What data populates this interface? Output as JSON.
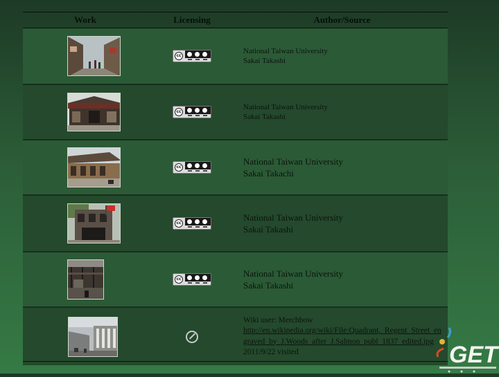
{
  "headers": {
    "work": "Work",
    "licensing": "Licensing",
    "author": "Author/Source"
  },
  "colors": {
    "row_light": "#2b5a36",
    "row_dark": "#24492c"
  },
  "license_icons": {
    "cc": "cc-by-nc-sa-badge",
    "pd": "public-domain-icon"
  },
  "rows": [
    {
      "license": "cc-by-nc-sa",
      "author_lines": [
        "National Taiwan University",
        "Sakai Takashi"
      ],
      "style": "small"
    },
    {
      "license": "cc-by-nc-sa",
      "author_lines": [
        "National Taiwan University",
        "Sakai Takashi"
      ],
      "style": "small"
    },
    {
      "license": "cc-by-nc-sa",
      "author_lines": [
        "National Taiwan University",
        "Sakai Takachi"
      ],
      "style": "large"
    },
    {
      "license": "cc-by-nc-sa",
      "author_lines": [
        "National Taiwan University",
        "Sakai Takashi"
      ],
      "style": "large"
    },
    {
      "license": "cc-by-nc-sa",
      "author_lines": [
        "National Taiwan University",
        "Sakai Takashi"
      ],
      "style": "large"
    },
    {
      "license": "public-domain",
      "author_lines": [
        "Wiki user: Merchbow"
      ],
      "link": "http://en.wikipedia.org/wiki/File:Quadrant,_Regent_Street_engraved_by_J.Woods_after_J.Salmon_publ_1837_edited.jpg",
      "visited": "2011/9/22 visited",
      "style": "wiki"
    }
  ],
  "logo": {
    "text": "GET"
  }
}
